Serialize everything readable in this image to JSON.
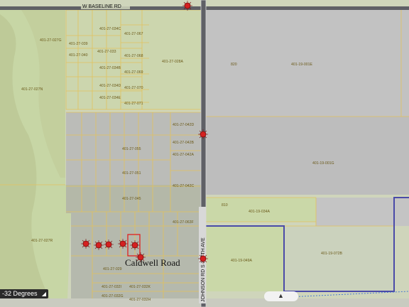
{
  "roads": {
    "baseline": "W BASELINE RD",
    "ave307": "S 307TH AVE",
    "johnson": "JOHNSON RD",
    "caldwell": "Caldwell Road"
  },
  "contours": {
    "c1": "820",
    "c2": "810"
  },
  "parcels": {
    "p034c": "401-27-034C",
    "p067": "401-27-067",
    "p027g": "401-27-027G",
    "p039": "401-27-039",
    "p040": "401-27-040",
    "p033": "401-27-033",
    "p068": "401-27-068",
    "p028a": "401-27-028A",
    "p034b": "401-27-034B",
    "p069": "401-27-069",
    "p027n": "401-27-027N",
    "p034d": "401-27-034D",
    "p070": "401-27-070",
    "p034e": "401-27-034E",
    "p071": "401-27-071",
    "p001e": "401-19-001E",
    "p042d": "401-27-042D",
    "p055": "401-27-055",
    "p042b": "401-27-042B",
    "p042a": "401-27-042A",
    "p001g": "401-19-001G",
    "p051": "401-27-051",
    "p042c": "401-27-042C",
    "p045": "401-27-045",
    "p034a": "401-19-034A",
    "p063f": "401-27-063F",
    "p027r": "401-27-027R",
    "p072b": "401-19-072B",
    "p049a": "401-19-049A",
    "p029": "401-27-029",
    "p032i": "401-27-032I",
    "p032k": "401-27-032K",
    "p032g": "401-27-032G",
    "p032h": "401-27-032H"
  },
  "badge": {
    "label": "-32 Degrees"
  },
  "colors": {
    "road": "#5f6066",
    "parcel_line": "#e0c060",
    "marker": "#d42020",
    "boundary": "#4a4aa8",
    "highlight": "#e02020"
  }
}
